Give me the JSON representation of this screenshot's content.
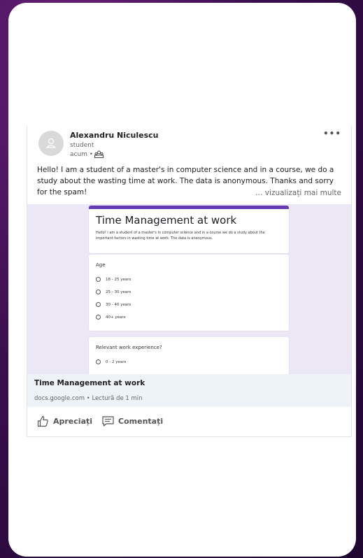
{
  "post": {
    "author_name": "Alexandru Niculescu",
    "author_headline": "student",
    "time": "acum •",
    "body": "Hello! I am a student of a master's in computer science and in a course, we do a study about the wasting time at work. The data is anonymous. Thanks and sorry for the spam!",
    "see_more": "… vizualizați mai multe",
    "more_label": "•••"
  },
  "preview": {
    "form_title": "Time Management at work",
    "form_description": "Hello! I am a student of a master's in computer science and in a course we do a study about the important factors in wasting time at work. The data is anonymous.",
    "question1": {
      "label": "Age",
      "options": [
        "18 - 25 years",
        "25 - 30 years",
        "30 - 40 years",
        "40+ years"
      ]
    },
    "question2": {
      "label": "Relevant work experience?",
      "options": [
        "0 - 2 years"
      ]
    }
  },
  "link": {
    "title": "Time Management at work",
    "subtitle": "docs.google.com • Lectură de 1 min"
  },
  "actions": {
    "like": "Apreciați",
    "comment": "Comentați"
  },
  "colors": {
    "form_accent": "#673ab7",
    "preview_bg": "#ece7f4"
  }
}
